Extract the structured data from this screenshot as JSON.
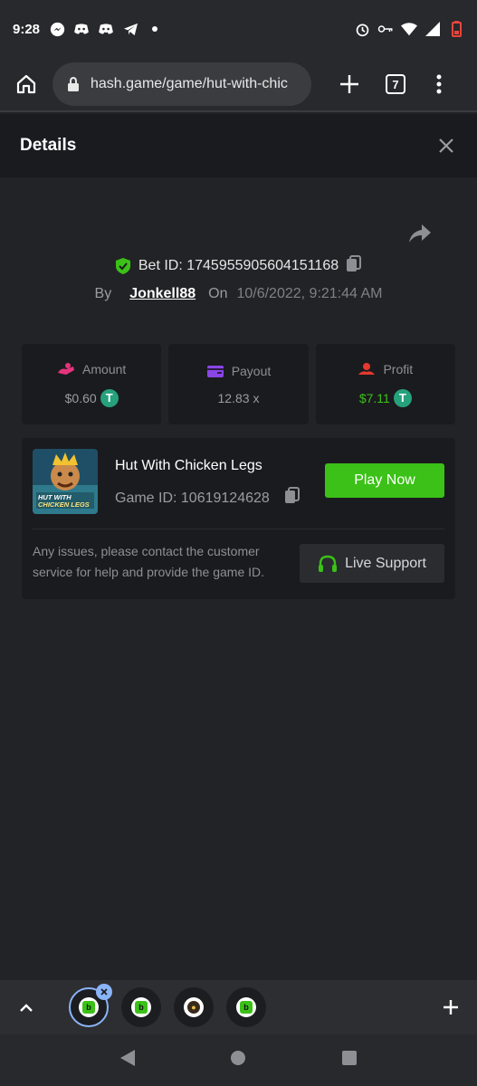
{
  "status_bar": {
    "time": "9:28",
    "left_icons": [
      "messenger-icon",
      "discord-icon",
      "discord-icon",
      "telegram-icon",
      "dot-icon"
    ],
    "right_icons": [
      "alarm-icon",
      "vpn-key-icon",
      "wifi-icon",
      "signal-icon",
      "battery-low-icon"
    ]
  },
  "browser": {
    "url": "hash.game/game/hut-with-chic",
    "tab_count": "7"
  },
  "details": {
    "title": "Details"
  },
  "bet": {
    "bet_id": "Bet ID: 1745955905604151168",
    "by_label": "By",
    "username": "Jonkell88",
    "on_label": "On",
    "date": "10/6/2022, 9:21:44 AM"
  },
  "stats": {
    "amount_label": "Amount",
    "amount_value": "$0.60",
    "payout_label": "Payout",
    "payout_value": "12.83 x",
    "profit_label": "Profit",
    "profit_value": "$7.11",
    "profit_color": "#3bc117"
  },
  "game": {
    "name": "Hut With Chicken Legs",
    "game_id": "Game ID: 10619124628",
    "thumb_text": "HUT WITH CHICKEN LEGS",
    "play_label": "Play Now",
    "help_text": "Any issues, please contact the customer service for help and provide the game ID.",
    "support_label": "Live Support"
  },
  "colors": {
    "accent": "#3bc117",
    "background": "#222326",
    "card": "#1a1b1e"
  }
}
